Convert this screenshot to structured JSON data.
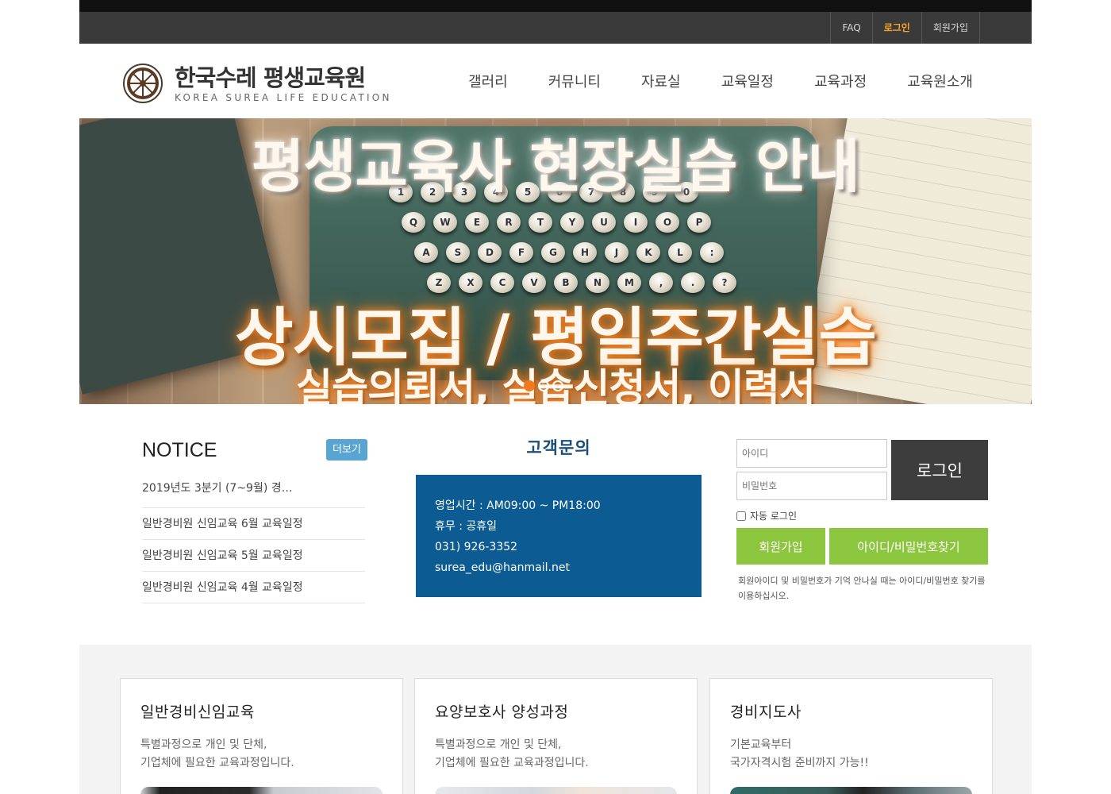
{
  "util_menu": {
    "faq": "FAQ",
    "login": "로그인",
    "join": "회원가입"
  },
  "logo": {
    "title": "한국수레 평생교육원",
    "subtitle": "KOREA SUREA LIFE EDUCATION"
  },
  "gnb": [
    "갤러리",
    "커뮤니티",
    "자료실",
    "교육일정",
    "교육과정",
    "교육원소개"
  ],
  "banner": {
    "line1": "평생교육사 현장실습 안내",
    "line2": "상시모집 / 평일주간실습",
    "line3": "실습의뢰서, 실습신청서, 이력서",
    "keys": [
      [
        "1",
        "2",
        "3",
        "4",
        "5",
        "6",
        "7",
        "8",
        "9",
        "0"
      ],
      [
        "Q",
        "W",
        "E",
        "R",
        "T",
        "Y",
        "U",
        "I",
        "O",
        "P"
      ],
      [
        "A",
        "S",
        "D",
        "F",
        "G",
        "H",
        "J",
        "K",
        "L",
        ":"
      ],
      [
        "Z",
        "X",
        "C",
        "V",
        "B",
        "N",
        "M",
        ",",
        ".",
        "?"
      ]
    ],
    "slide_count": 3,
    "active_slide": 1
  },
  "notice": {
    "title": "NOTICE",
    "more": "더보기",
    "items": [
      "2019년도 3분기 (7~9월) 경…",
      "일반경비원 신임교육 6월 교육일정",
      "일반경비원 신임교육 5월 교육일정",
      "일반경비원 신임교육 4월 교육일정"
    ]
  },
  "customer": {
    "title": "고객문의",
    "hours": "영업시간 : AM09:00 ~ PM18:00",
    "holiday": "휴무 : 공휴일",
    "phone": "031) 926-3352",
    "email": "surea_edu@hanmail.net"
  },
  "login": {
    "id_placeholder": "아이디",
    "pw_placeholder": "비밀번호",
    "login_button": "로그인",
    "auto_login": "자동 로그인",
    "join_button": "회원가입",
    "find_button": "아이디/비밀번호찾기",
    "help": "회원아이디 및 비밀번호가 기억 안나실 때는 아이디/비밀번호 찾기를 이용하십시오."
  },
  "courses": [
    {
      "title": "일반경비신임교육",
      "desc": "특별과정으로 개인 및 단체,\n기업체에 필요한 교육과정입니다."
    },
    {
      "title": "요양보호사 양성과정",
      "desc": "특별과정으로 개인 및 단체,\n기업체에 필요한 교육과정입니다."
    },
    {
      "title": "경비지도사",
      "desc": "기본교육부터\n국가자격시험 준비까지 가능!!"
    }
  ],
  "colors": {
    "accent_orange": "#f5a623",
    "customer_blue": "#0c5c93",
    "login_green": "#8cc63e",
    "more_blue": "#58a5d4"
  }
}
